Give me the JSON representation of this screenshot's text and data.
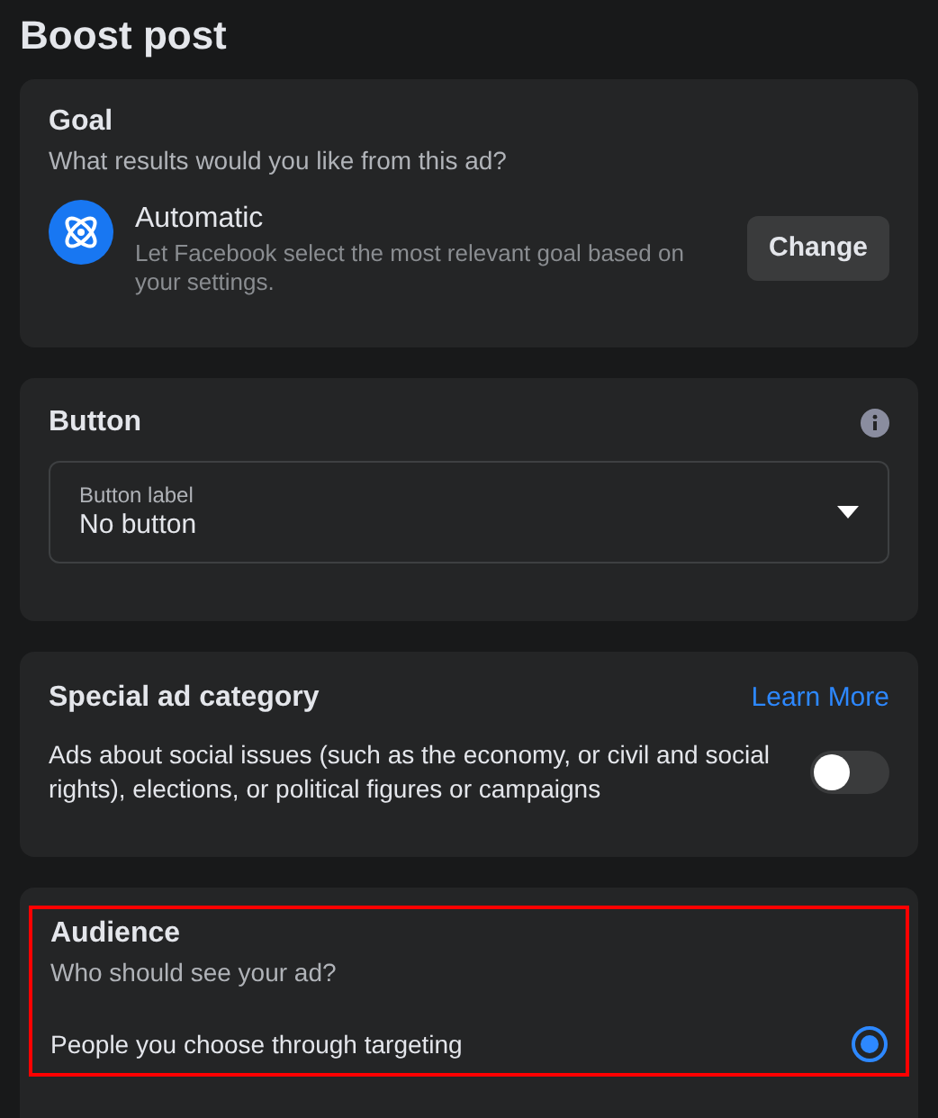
{
  "title": "Boost post",
  "goal": {
    "heading": "Goal",
    "subtitle": "What results would you like from this ad?",
    "option_title": "Automatic",
    "option_description": "Let Facebook select the most relevant goal based on your settings.",
    "button": "Change"
  },
  "button_section": {
    "heading": "Button",
    "field": {
      "label": "Button label",
      "value": "No button"
    }
  },
  "special_ad_category": {
    "heading": "Special ad category",
    "link": "Learn More",
    "description": "Ads about social issues (such as the economy, or civil and social rights), elections, or political figures or campaigns",
    "on": false
  },
  "audience": {
    "heading": "Audience",
    "subtitle": "Who should see your ad?",
    "highlighted": true,
    "options": [
      {
        "label": "People you choose through targeting",
        "selected": true
      }
    ]
  }
}
